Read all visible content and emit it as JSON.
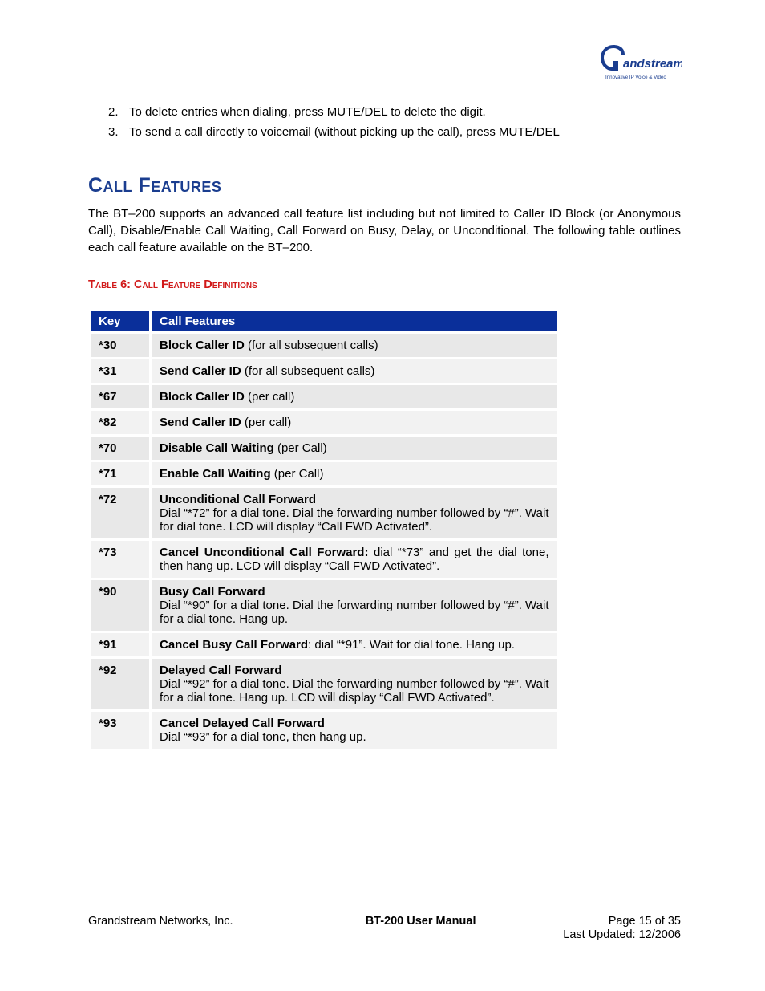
{
  "logo": {
    "brand": "Grandstream",
    "tagline": "Innovative IP Voice & Video",
    "accent_color": "#1a3d8f"
  },
  "ordered_items": [
    {
      "num": "2.",
      "text": "To delete entries when dialing, press MUTE/DEL to delete the digit."
    },
    {
      "num": "3.",
      "text": "To send a call directly to voicemail (without picking up the call), press MUTE/DEL"
    }
  ],
  "section_heading": "Call Features",
  "intro_paragraph": "The BT–200 supports an advanced call feature list including but not limited to Caller ID Block (or Anonymous Call), Disable/Enable Call Waiting, Call Forward on Busy, Delay, or Unconditional.  The following table outlines each call feature available on the BT–200.",
  "table_caption": "Table 6:  Call Feature Definitions",
  "table_headers": {
    "key": "Key",
    "feature": "Call Features"
  },
  "features": [
    {
      "key": "*30",
      "title": "Block Caller ID",
      "extra": " (for all subsequent calls)",
      "desc": ""
    },
    {
      "key": "*31",
      "title": "Send Caller ID",
      "extra": " (for all subsequent calls)",
      "desc": ""
    },
    {
      "key": "*67",
      "title": "Block Caller ID",
      "extra": " (per call)",
      "desc": ""
    },
    {
      "key": "*82",
      "title": "Send Caller ID",
      "extra": " (per call)",
      "desc": ""
    },
    {
      "key": "*70",
      "title": "Disable Call Waiting",
      "extra": " (per Call)",
      "desc": ""
    },
    {
      "key": "*71",
      "title": "Enable Call Waiting",
      "extra": " (per Call)",
      "desc": ""
    },
    {
      "key": "*72",
      "title": "Unconditional Call Forward",
      "extra": "",
      "desc": "Dial “*72” for a dial tone. Dial the forwarding number followed by “#”.  Wait for dial tone.  LCD will display “Call FWD Activated”."
    },
    {
      "key": "*73",
      "title": "Cancel Unconditional Call Forward:",
      "extra": "  dial “*73” and get the dial tone, then hang up. LCD will display “Call FWD Activated”.",
      "desc": ""
    },
    {
      "key": "*90",
      "title": "Busy Call Forward",
      "extra": "",
      "desc": "Dial “*90” for a dial tone. Dial the forwarding number followed by “#”.  Wait for a dial tone. Hang up."
    },
    {
      "key": "*91",
      "title": "Cancel Busy Call Forward",
      "extra": ": dial “*91”.  Wait for dial tone.  Hang up.",
      "desc": ""
    },
    {
      "key": "*92",
      "title": "Delayed Call Forward",
      "extra": "",
      "desc": "Dial “*92” for a dial tone.  Dial the forwarding number followed by “#”.  Wait for a dial tone. Hang up. LCD will display “Call FWD Activated”."
    },
    {
      "key": "*93",
      "title": "Cancel Delayed Call Forward",
      "extra": "",
      "desc": "Dial “*93” for a dial tone, then hang up."
    }
  ],
  "footer": {
    "left": "Grandstream Networks, Inc.",
    "center": "BT-200 User Manual",
    "right": "Page 15 of 35",
    "updated": "Last Updated:  12/2006"
  }
}
